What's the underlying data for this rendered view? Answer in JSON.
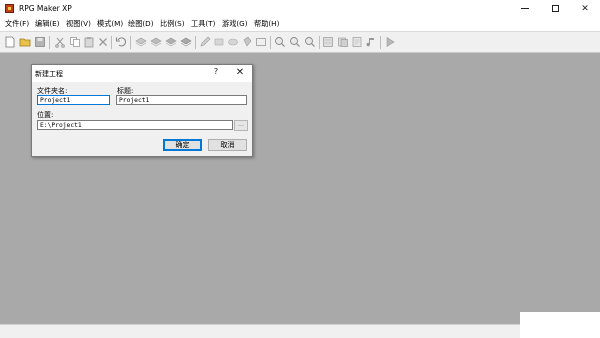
{
  "window": {
    "title": "RPG Maker XP"
  },
  "menu": [
    {
      "label": "文件(F)"
    },
    {
      "label": "编辑(E)"
    },
    {
      "label": "视图(V)"
    },
    {
      "label": "模式(M)"
    },
    {
      "label": "绘图(D)"
    },
    {
      "label": "比例(S)"
    },
    {
      "label": "工具(T)"
    },
    {
      "label": "游戏(G)"
    },
    {
      "label": "帮助(H)"
    }
  ],
  "toolbar": {
    "icons": [
      "new-project-icon",
      "open-project-icon",
      "save-icon",
      "cut-icon",
      "copy-icon",
      "paste-icon",
      "delete-icon",
      "undo-icon",
      "layer-1-icon",
      "layer-2-icon",
      "layer-3-icon",
      "event-layer-icon",
      "pencil-icon",
      "rectangle-tool-icon",
      "ellipse-tool-icon",
      "fill-tool-icon",
      "select-tool-icon",
      "zoom-1-icon",
      "zoom-2-icon",
      "zoom-4-icon",
      "database-icon",
      "material-base-icon",
      "script-editor-icon",
      "sound-test-icon",
      "playtest-icon"
    ]
  },
  "dialog": {
    "title": "新建工程",
    "help_label": "?",
    "close_label": "✕",
    "folder_label": "文件夹名:",
    "folder_value": "Project1",
    "title_label": "标题:",
    "title_value": "Project1",
    "location_label": "位置:",
    "location_value": "E:\\Project1",
    "browse_label": "...",
    "ok_label": "确定",
    "cancel_label": "取消"
  },
  "colors": {
    "workspace": "#a9a9a9",
    "dialog_bg": "#f0f0f0",
    "focus": "#0078d7"
  }
}
